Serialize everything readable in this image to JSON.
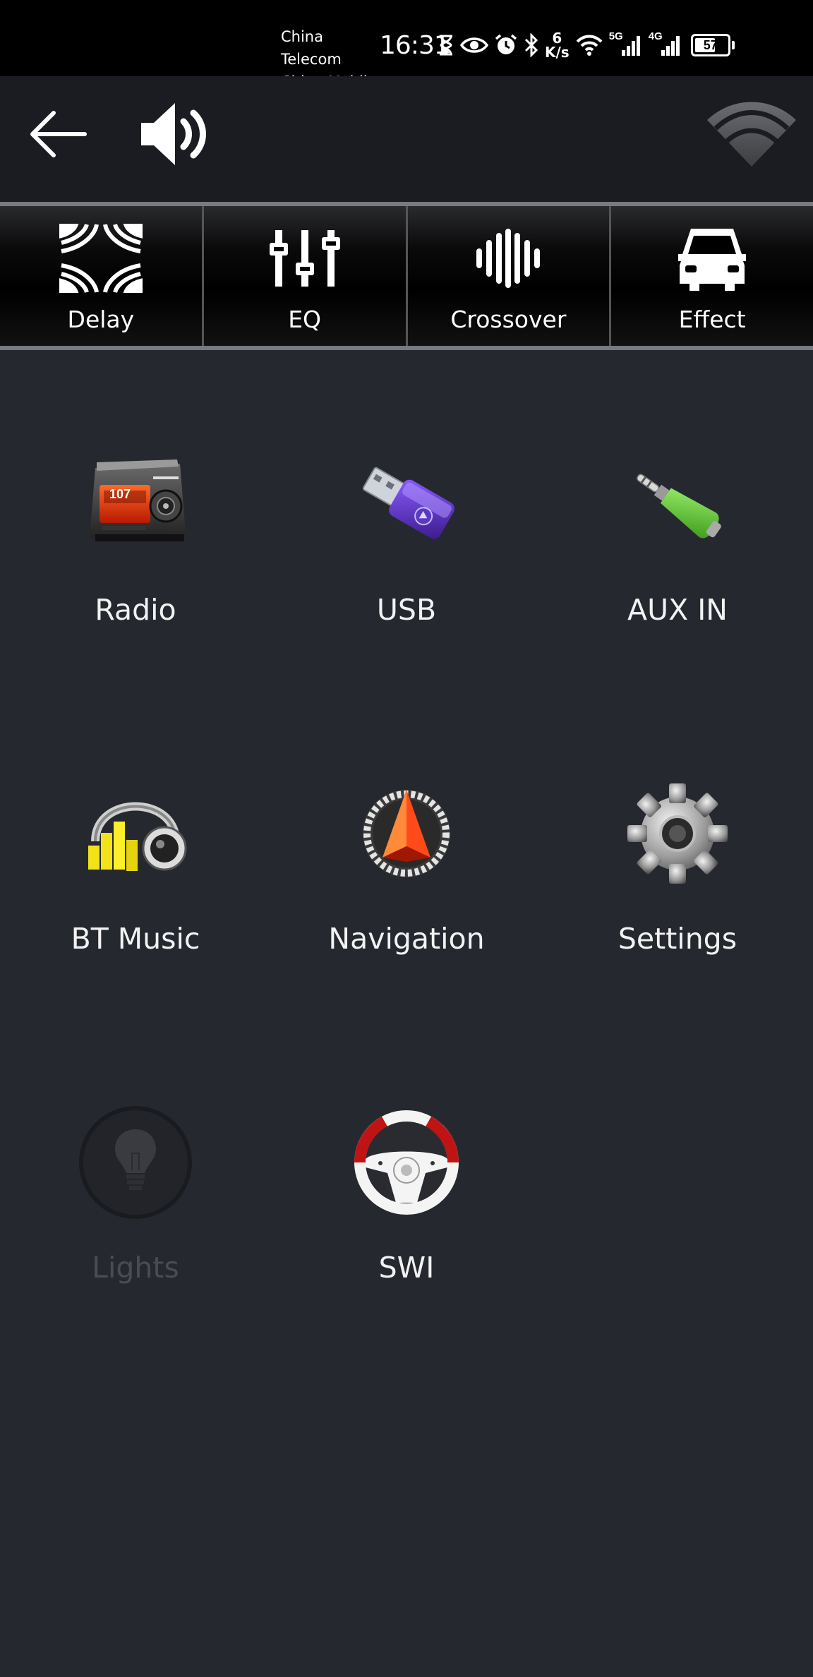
{
  "status_bar": {
    "carrier_1": "China Telecom",
    "carrier_2": "China Mobile",
    "time": "16:31",
    "speed_value": "6",
    "speed_unit": "K/s",
    "network_1": "5G",
    "network_2": "4G",
    "battery": "57"
  },
  "header": {
    "back_icon": "arrow-left-icon",
    "volume_icon": "speaker-icon",
    "wifi_icon": "wifi-icon"
  },
  "tabs": [
    {
      "label": "Delay",
      "icon": "delay-icon"
    },
    {
      "label": "EQ",
      "icon": "equalizer-sliders-icon"
    },
    {
      "label": "Crossover",
      "icon": "crossover-waveform-icon"
    },
    {
      "label": "Effect",
      "icon": "car-icon"
    }
  ],
  "apps": [
    {
      "label": "Radio",
      "icon": "radio-icon",
      "enabled": true
    },
    {
      "label": "USB",
      "icon": "usb-drive-icon",
      "enabled": true
    },
    {
      "label": "AUX IN",
      "icon": "aux-plug-icon",
      "enabled": true
    },
    {
      "label": "BT Music",
      "icon": "headphones-icon",
      "enabled": true
    },
    {
      "label": "Navigation",
      "icon": "compass-icon",
      "enabled": true
    },
    {
      "label": "Settings",
      "icon": "gear-icon",
      "enabled": true
    },
    {
      "label": "Lights",
      "icon": "light-bulb-icon",
      "enabled": false
    },
    {
      "label": "SWI",
      "icon": "steering-wheel-icon",
      "enabled": true
    }
  ],
  "radio_display": "107",
  "colors": {
    "background": "#262830",
    "header": "#1a1c21",
    "status_bar": "#000000",
    "disabled_text": "#4a4c52"
  }
}
